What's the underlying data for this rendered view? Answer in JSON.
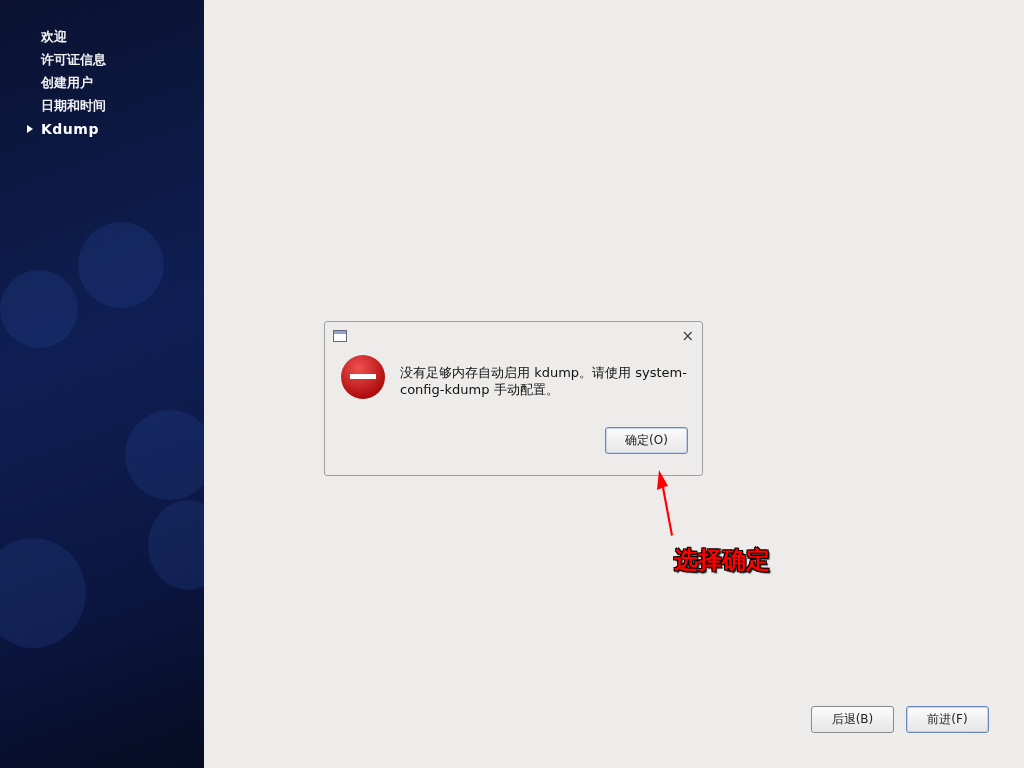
{
  "sidebar": {
    "items": [
      {
        "label": "欢迎",
        "selected": false
      },
      {
        "label": "许可证信息",
        "selected": false
      },
      {
        "label": "创建用户",
        "selected": false
      },
      {
        "label": "日期和时间",
        "selected": false
      },
      {
        "label": "Kdump",
        "selected": true
      }
    ]
  },
  "dialog": {
    "message": "没有足够内存自动启用 kdump。请使用 system-config-kdump 手动配置。",
    "close": "×",
    "button": "确定(O)"
  },
  "annotation": {
    "text": "选择确定"
  },
  "buttons": [
    {
      "label": "后退(B)",
      "default": false
    },
    {
      "label": "前进(F)",
      "default": true
    }
  ]
}
